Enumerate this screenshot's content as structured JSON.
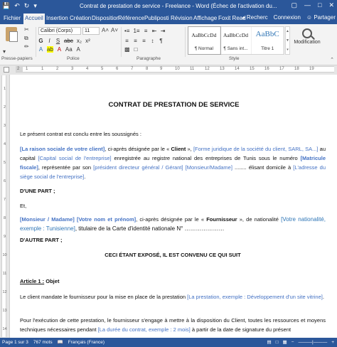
{
  "window": {
    "title": "Contrat de prestation de service - Freelance - Word (Échec de l'activation du...",
    "qat": {
      "save_icon": "save-icon",
      "undo_icon": "undo-icon",
      "redo_icon": "redo-icon",
      "customize_icon": "customize-icon"
    },
    "controls": [
      "—",
      "□",
      "✕"
    ]
  },
  "tabs": [
    "Fichier",
    "Accueil",
    "Insertion",
    "Création",
    "Disposition",
    "Référence",
    "Publiposti",
    "Révision",
    "Affichage",
    "Foxit Read"
  ],
  "active_tab": "Accueil",
  "tabs_right": {
    "search": "Recherc",
    "login": "Connexion",
    "share": "Partager"
  },
  "ribbon": {
    "groups": {
      "clipboard": "Presse-papiers",
      "font": "Police",
      "paragraph": "Paragraphe",
      "styles": "Style"
    },
    "font_name": "Calibri (Corps)",
    "font_size": "11",
    "font_buttons": [
      "G",
      "I",
      "S",
      "abc",
      "x₂",
      "x²"
    ],
    "font_buttons2": [
      "A",
      "ab",
      "A",
      "Aa",
      "A"
    ],
    "para_buttons": [
      "≡",
      "≡",
      "≡",
      "⇤",
      "⇥",
      "↕",
      "¶"
    ],
    "styles": [
      {
        "sample": "AaBbCcDd",
        "name": "¶ Normal"
      },
      {
        "sample": "AaBbCcDd",
        "name": "¶ Sans int..."
      },
      {
        "sample": "AaBbC",
        "name": "Titre 1"
      }
    ],
    "modify_label": "Modification"
  },
  "ruler": {
    "ticks": [
      "2",
      "1",
      "1",
      "2",
      "3",
      "4",
      "5",
      "6",
      "7",
      "8",
      "9",
      "10",
      "11",
      "12",
      "13",
      "14",
      "15",
      "16",
      "17",
      "18",
      "19"
    ]
  },
  "vruler": {
    "ticks": [
      "1",
      "2",
      "3",
      "4",
      "5",
      "6",
      "7",
      "8",
      "9",
      "10",
      "11",
      "12",
      "13",
      "14"
    ]
  },
  "document": {
    "title": "CONTRAT DE PRESTATION DE SERVICE",
    "intro": "Le présent contrat est conclu entre les soussignés :",
    "party1": {
      "company_placeholder": "[La raison sociale de votre client]",
      "text1": ", ci-après désignée par le « ",
      "client": "Client",
      "text2": " », ",
      "legal_form_placeholder": "[Forme juridique de la société du client, SARL, SA...]",
      "text3": " au capital ",
      "capital_placeholder": "[Capital social de l'entreprise]",
      "text4": " enregistrée au registre national des entreprises de Tunis sous le numéro ",
      "tax_placeholder": "[Matricule fiscale]",
      "text5": ", représentée par son ",
      "rep_placeholder": "[président directeur général / Gérant]",
      "text6": " ",
      "title_placeholder": "[Monsieur/Madame]",
      "text7": " ........ élisant domicile à ",
      "address_placeholder": "[L'adresse du siège social de l'entreprise]",
      "text8": "."
    },
    "first_part": "D'UNE PART ;",
    "et": "Et,",
    "party2": {
      "title_placeholder": "[Monsieur / Madame]",
      "name_placeholder": "[Votre nom et prénom]",
      "text1": ", ci-après désignée par le « ",
      "supplier": "Fournisseur",
      "text2": " », de nationalité ",
      "nationality_placeholder": "[Votre nationalité, exemple : Tunisienne]",
      "text3": ", titulaire de la Carte d'identité nationale N° …………………"
    },
    "second_part": "D'AUTRE PART ;",
    "exposed": "CECI ÉTANT EXPOSÉ, IL EST CONVENU CE QUI SUIT",
    "article1_heading": "Article 1 :",
    "article1_title": " Objet",
    "article1_text1": "Le client mandate le fournisseur pour la mise en place de la prestation ",
    "article1_placeholder": "[La prestation, exemple : Développement d'un site vitrine]",
    "article1_text2": ".",
    "article1_p2_text1": "Pour l'exécution de cette prestation, le fournisseur s'engage à mettre à la disposition du Client, toutes les ressources et moyens techniques nécessaires pendant ",
    "article1_p2_placeholder": "[La durée du contrat, exemple : 2 mois]",
    "article1_p2_text2": " à partir de la date de signature du présent"
  },
  "status": {
    "page": "Page 1 sur 3",
    "words": "767 mots",
    "lang": "Français (France)",
    "zoom_minus": "−",
    "zoom_plus": "+"
  }
}
